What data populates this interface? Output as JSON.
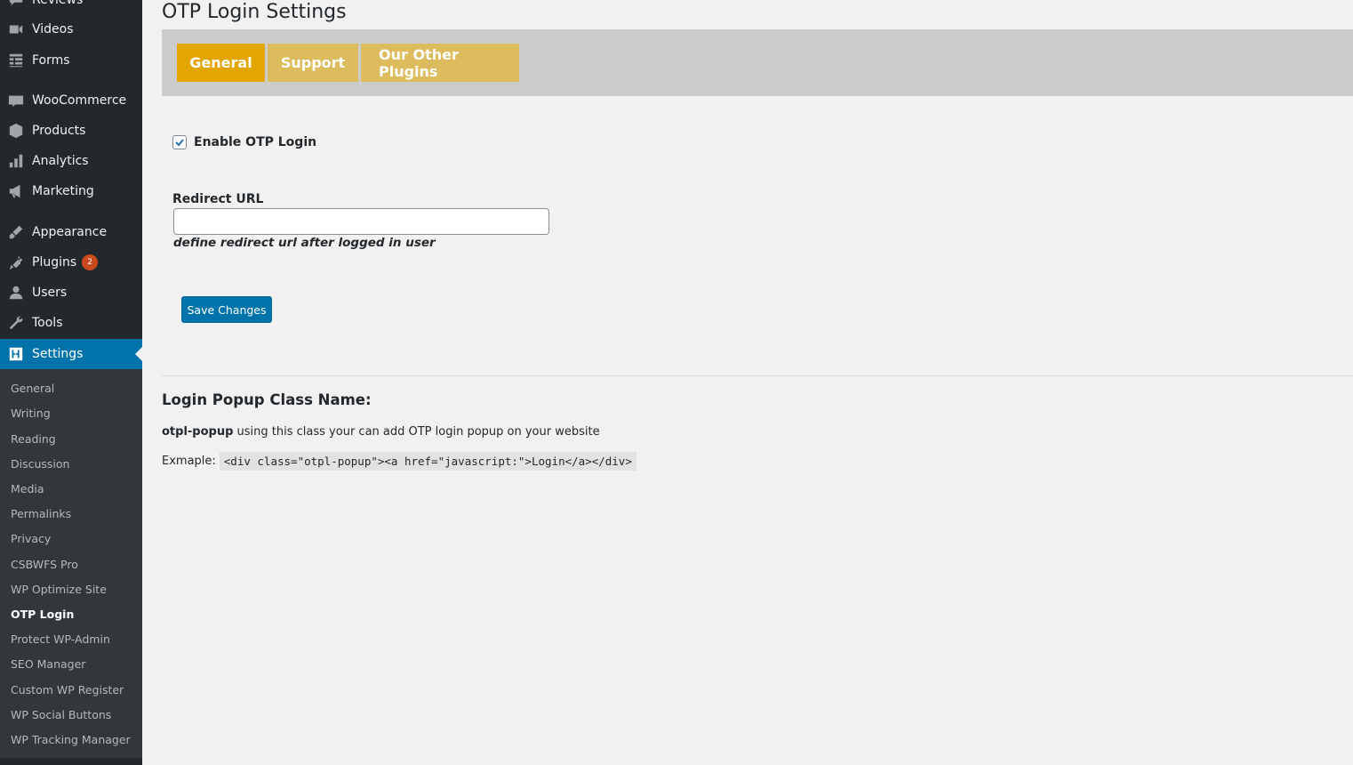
{
  "sidebar": {
    "top_items": [
      {
        "label": "Reviews",
        "icon": "reviews-icon"
      },
      {
        "label": "Videos",
        "icon": "video-icon"
      },
      {
        "label": "Forms",
        "icon": "forms-icon"
      },
      {
        "label": "WooCommerce",
        "icon": "woocommerce-icon"
      },
      {
        "label": "Products",
        "icon": "products-icon"
      },
      {
        "label": "Analytics",
        "icon": "analytics-icon"
      },
      {
        "label": "Marketing",
        "icon": "marketing-icon"
      },
      {
        "label": "Appearance",
        "icon": "appearance-icon"
      },
      {
        "label": "Plugins",
        "icon": "plugins-icon",
        "badge": "2"
      },
      {
        "label": "Users",
        "icon": "users-icon"
      },
      {
        "label": "Tools",
        "icon": "tools-icon"
      },
      {
        "label": "Settings",
        "icon": "settings-icon",
        "current": true
      }
    ],
    "submenu": [
      "General",
      "Writing",
      "Reading",
      "Discussion",
      "Media",
      "Permalinks",
      "Privacy",
      "CSBWFS Pro",
      "WP Optimize Site",
      "OTP Login",
      "Protect WP-Admin",
      "SEO Manager",
      "Custom WP Register",
      "WP Social Buttons",
      "WP Tracking Manager"
    ],
    "submenu_current": "OTP Login"
  },
  "page": {
    "title": "OTP Login Settings",
    "tabs": [
      {
        "label": "General",
        "active": true
      },
      {
        "label": "Support",
        "active": false
      },
      {
        "label": "Our Other Plugins",
        "active": false
      }
    ],
    "enable_otp": {
      "label": "Enable OTP Login",
      "checked": true
    },
    "redirect": {
      "label": "Redirect URL",
      "value": "",
      "help": "define redirect url after logged in user"
    },
    "save_label": "Save Changes",
    "section": {
      "heading": "Login Popup Class Name:",
      "class_name": "otpl-popup",
      "class_desc": "using this class your can add OTP login popup on your website",
      "example_label": "Exmaple:",
      "example_code": "<div class=\"otpl-popup\"><a href=\"javascript:\">Login</a></div>"
    }
  },
  "colors": {
    "sidebar_bg": "#23282d",
    "submenu_bg": "#32373c",
    "accent_blue": "#0073aa",
    "tab_active": "#e3a500",
    "tab_inactive": "#ddbc5d",
    "badge": "#ca4a1f"
  }
}
